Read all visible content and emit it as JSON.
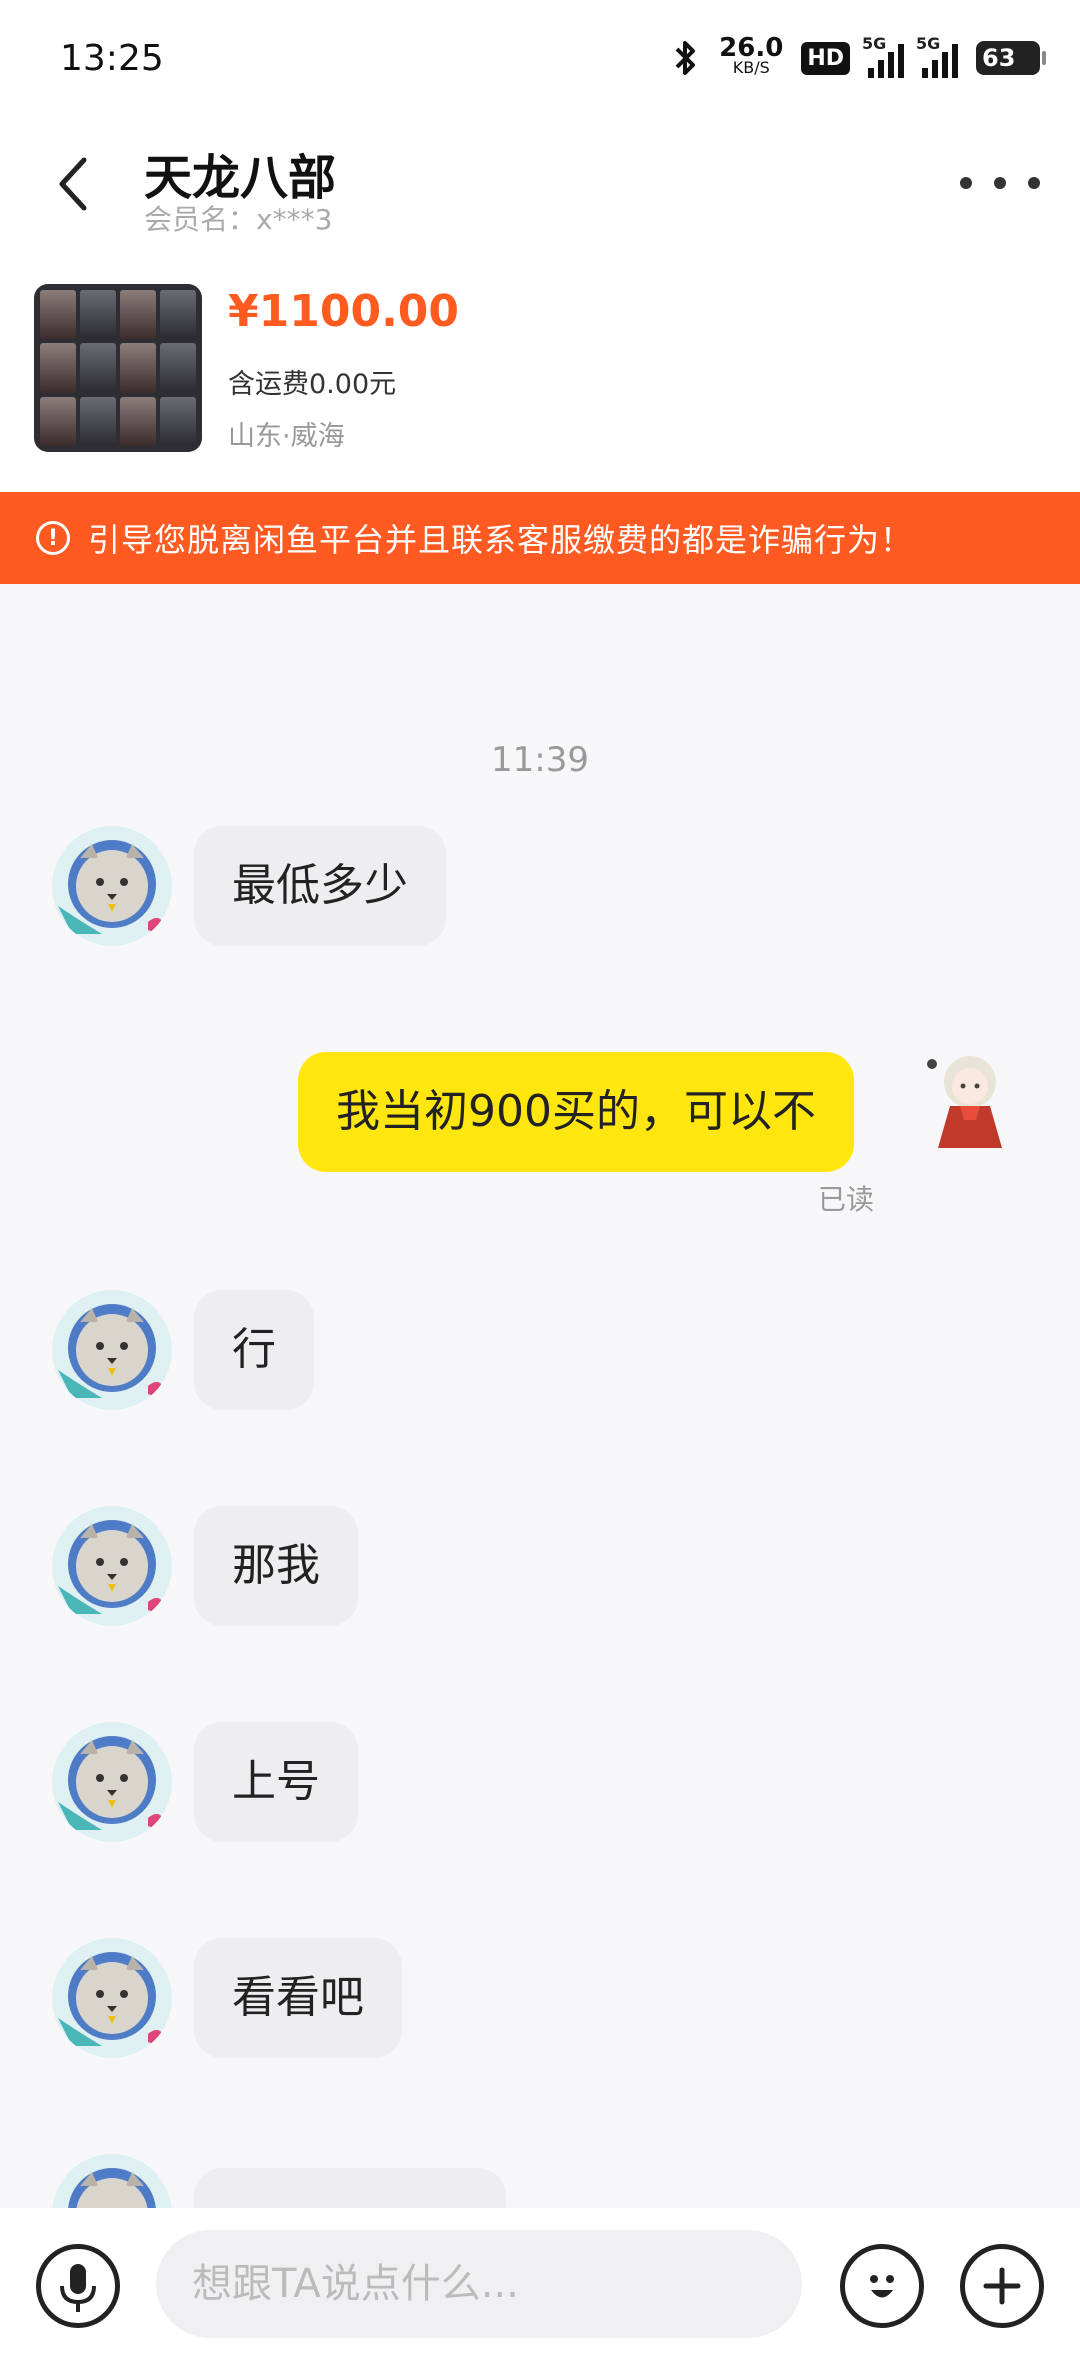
{
  "status_bar": {
    "time": "13:25",
    "speed_value": "26.0",
    "speed_unit": "KB/S",
    "hd_label": "HD",
    "signal1_label": "5G",
    "signal2_label": "5G",
    "battery": "63"
  },
  "header": {
    "title": "天龙八部",
    "subtitle": "会员名：x***3"
  },
  "product": {
    "price": "¥1100.00",
    "shipping": "含运费0.00元",
    "location": "山东·威海"
  },
  "warning": {
    "text": "引导您脱离闲鱼平台并且联系客服缴费的都是诈骗行为！",
    "color": "#ff5a22"
  },
  "chat": {
    "time_separator": "11:39",
    "messages": [
      {
        "side": "in",
        "text": "最低多少"
      },
      {
        "side": "out",
        "text": "我当初900买的，可以不",
        "status": "已读"
      },
      {
        "side": "in",
        "text": "行"
      },
      {
        "side": "in",
        "text": "那我"
      },
      {
        "side": "in",
        "text": "上号"
      },
      {
        "side": "in",
        "text": "看看吧"
      }
    ]
  },
  "input": {
    "placeholder": "想跟TA说点什么..."
  },
  "colors": {
    "accent_price": "#ff5a1f",
    "outgoing_bubble": "#ffe60f",
    "incoming_bubble": "#eeeef1"
  },
  "icons": [
    "back-arrow-icon",
    "more-dots-icon",
    "warning-icon",
    "microphone-icon",
    "emoji-icon",
    "plus-icon"
  ]
}
